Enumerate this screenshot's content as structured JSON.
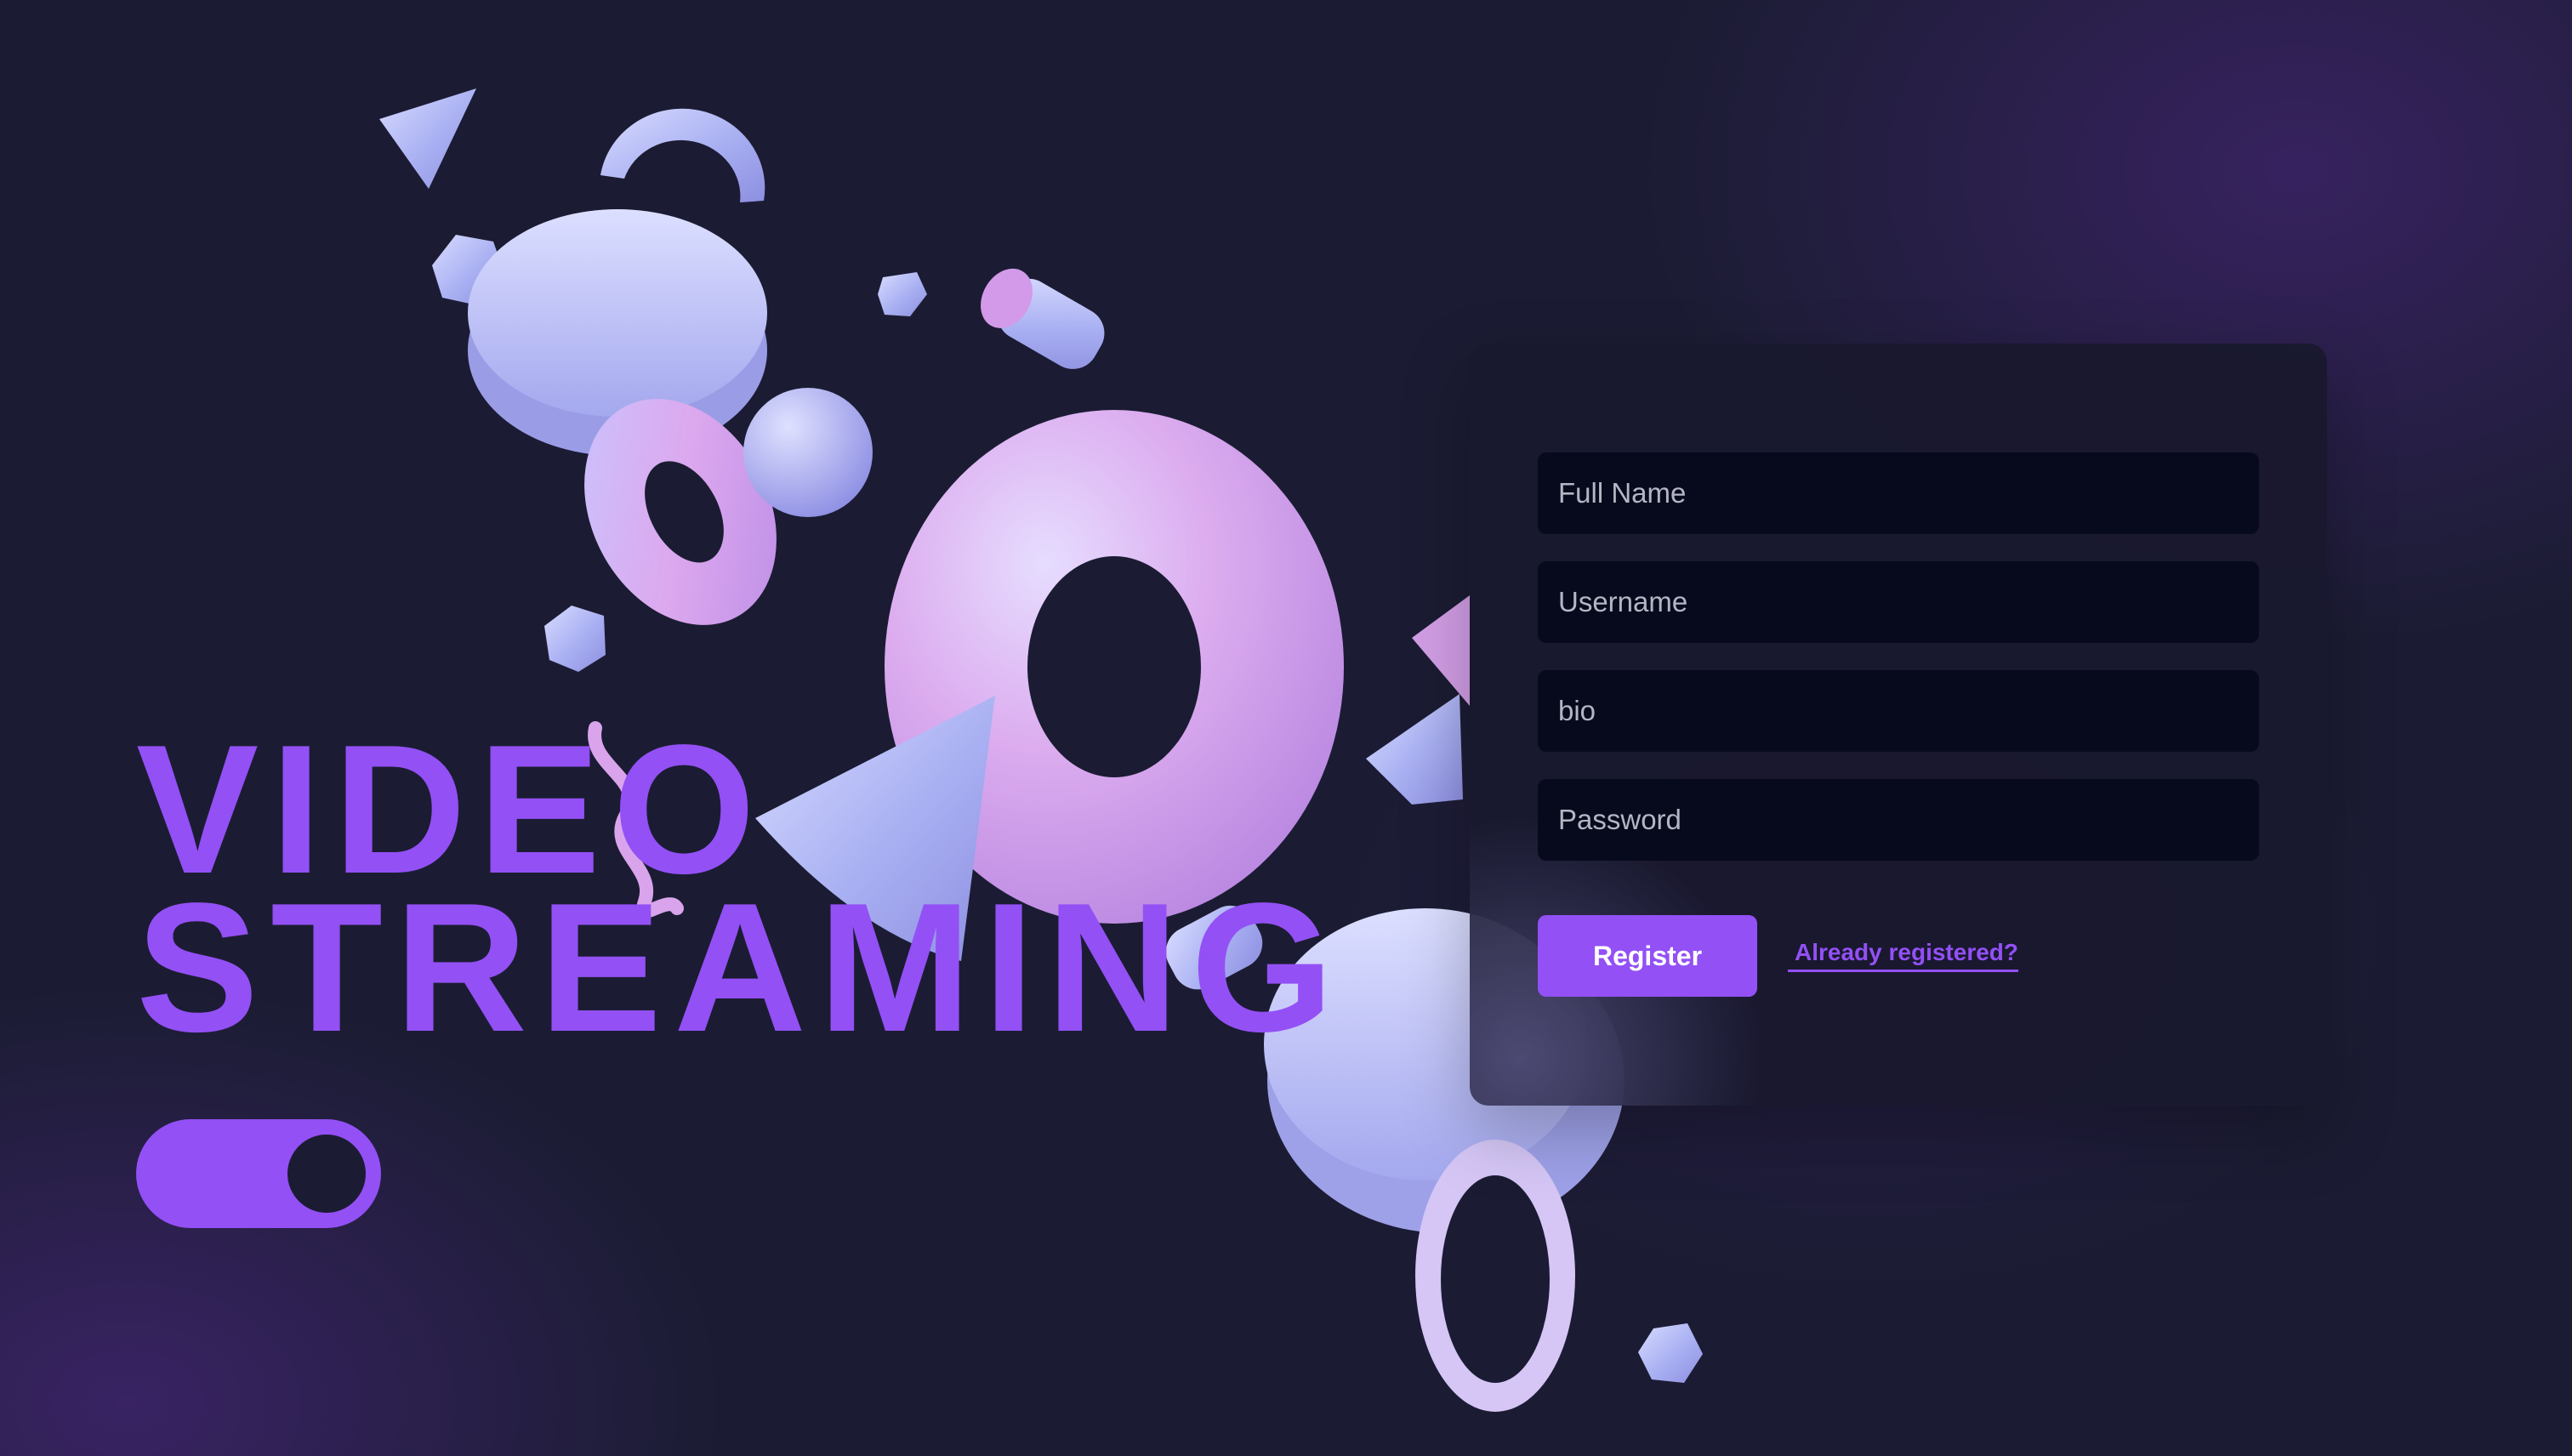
{
  "hero": {
    "line1": "VIDEO",
    "line2": "STREAMING"
  },
  "theme_toggle": {
    "state": "on"
  },
  "register_form": {
    "full_name_placeholder": "Full Name",
    "username_placeholder": "Username",
    "bio_placeholder": "bio",
    "password_placeholder": "Password",
    "submit_label": "Register",
    "login_link_label": "Already registered?"
  },
  "colors": {
    "accent": "#9350f5",
    "background": "#1b1c33",
    "card": "#18182e",
    "input": "#070a1d"
  },
  "decor": [
    "cone-shape",
    "half-ring-shape",
    "hemisphere-shape",
    "torus-shape",
    "sphere-shape",
    "cylinder-shape",
    "hexagon-shape",
    "squiggle-shape",
    "ring-shape"
  ]
}
